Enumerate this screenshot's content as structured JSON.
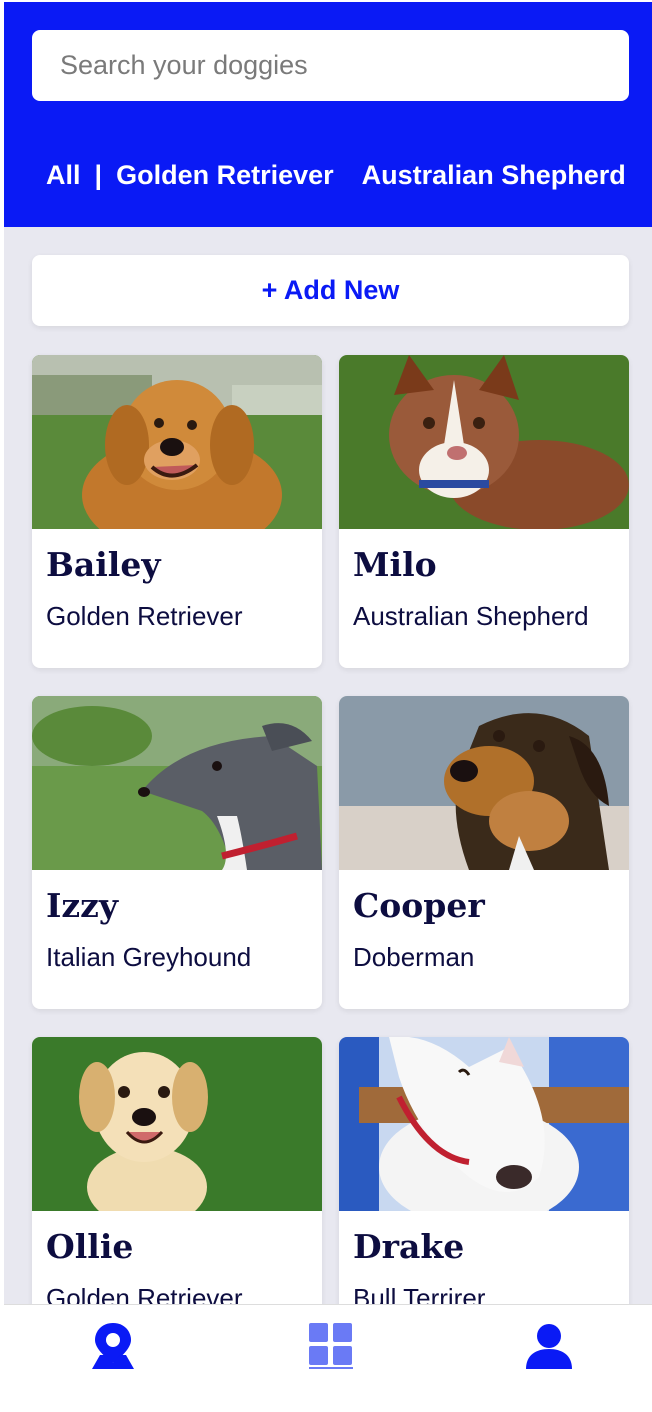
{
  "search": {
    "placeholder": "Search your doggies"
  },
  "filters": [
    {
      "label": "All"
    },
    {
      "label": "|"
    },
    {
      "label": "Golden Retriever"
    },
    {
      "label": "Australian Shepherd"
    }
  ],
  "add_button": {
    "label": "+ Add New"
  },
  "dogs": [
    {
      "name": "Bailey",
      "breed": "Golden Retriever",
      "photo": "golden-retriever-photo"
    },
    {
      "name": "Milo",
      "breed": "Australian Shepherd",
      "photo": "australian-shepherd-puppy-photo"
    },
    {
      "name": "Izzy",
      "breed": "Italian Greyhound",
      "photo": "italian-greyhound-photo"
    },
    {
      "name": "Cooper",
      "breed": "Doberman",
      "photo": "doberman-mix-photo"
    },
    {
      "name": "Ollie",
      "breed": "Golden Retriever",
      "photo": "golden-retriever-puppy-photo"
    },
    {
      "name": "Drake",
      "breed": "Bull Terrirer",
      "photo": "bull-terrier-photo"
    }
  ],
  "bottom_nav": {
    "items": [
      {
        "icon": "map-pin-icon"
      },
      {
        "icon": "grid-icon"
      },
      {
        "icon": "user-icon"
      }
    ]
  },
  "colors": {
    "accent": "#0a1af5",
    "text_dark": "#0d0d40",
    "background": "#e8e8f0"
  }
}
